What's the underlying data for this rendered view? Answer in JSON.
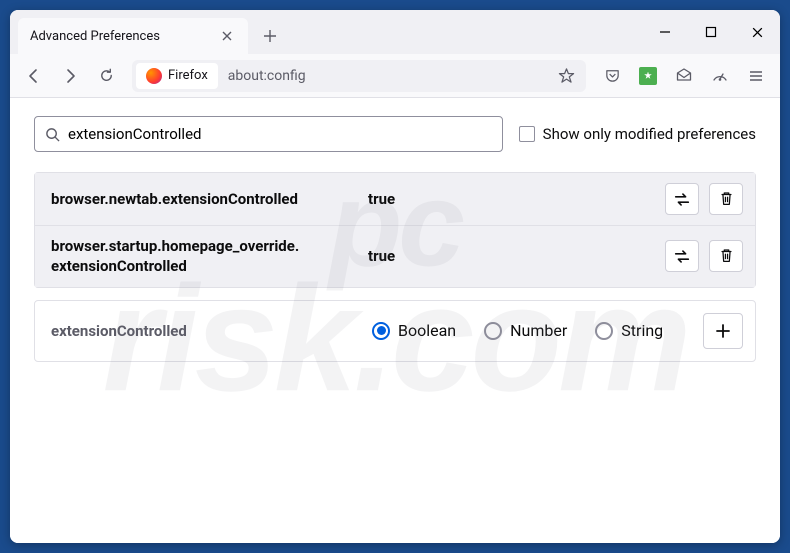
{
  "window": {
    "tab_title": "Advanced Preferences"
  },
  "toolbar": {
    "identity_label": "Firefox",
    "url": "about:config"
  },
  "search": {
    "value": "extensionControlled",
    "checkbox_label": "Show only modified preferences"
  },
  "prefs": [
    {
      "name": "browser.newtab.extensionControlled",
      "value": "true"
    },
    {
      "name": "browser.startup.homepage_override.extensionControlled",
      "value": "true"
    }
  ],
  "create": {
    "name": "extensionControlled",
    "types": [
      "Boolean",
      "Number",
      "String"
    ],
    "selected": 0
  }
}
